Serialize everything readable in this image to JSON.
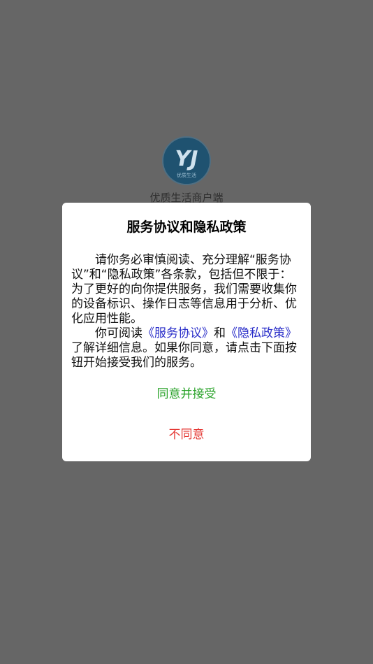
{
  "splash": {
    "app_name": "优质生活商户端",
    "logo_text": "优质生活",
    "logo_letters": "YJ"
  },
  "dialog": {
    "title": "服务协议和隐私政策",
    "para1": "请你务必审慎阅读、充分理解“服务协议”和“隐私政策”各条款，包括但不限于：为了更好的向你提供服务，我们需要收集你的设备标识、操作日志等信息用于分析、优化应用性能。",
    "para2_prefix": "你可阅读",
    "service_link": "《服务协议》",
    "para2_and": "和",
    "privacy_link": "《隐私政策》",
    "para2_suffix": "了解详细信息。如果你同意，请点击下面按钮开始接受我们的服务。",
    "agree_label": "同意并接受",
    "disagree_label": "不同意"
  },
  "colors": {
    "overlay": "#666666",
    "link": "#2a2ec9",
    "agree": "#28a228",
    "disagree": "#e53935"
  }
}
